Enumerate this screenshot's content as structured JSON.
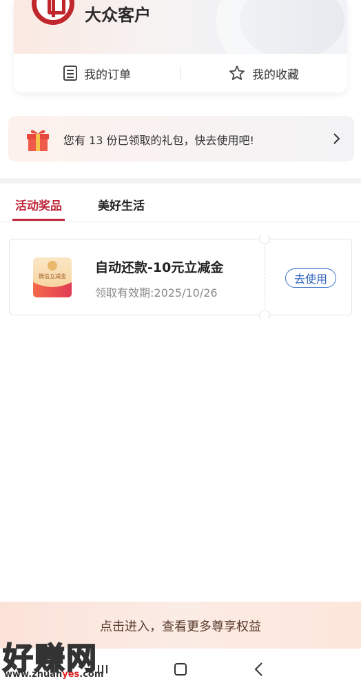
{
  "profile": {
    "name": "大众客户",
    "quick_links": [
      {
        "label": "我的订单",
        "icon": "orders-icon"
      },
      {
        "label": "我的收藏",
        "icon": "star-icon"
      }
    ]
  },
  "gift_banner": {
    "text": "您有 13 份已领取的礼包，快去使用吧!",
    "icon": "gift-icon"
  },
  "tabs": [
    {
      "label": "活动奖品",
      "active": true
    },
    {
      "label": "美好生活",
      "active": false
    }
  ],
  "coupon": {
    "title": "自动还款-10元立减金",
    "expiry": "领取有效期:2025/10/26",
    "button_label": "去使用",
    "image_label": "微信立减金"
  },
  "bottom_banner": {
    "text": "点击进入，查看更多尊享权益"
  },
  "watermark": {
    "big": "好赚网",
    "url_prefix": "www.zhuan",
    "url_highlight": "yes",
    "url_suffix": ".com"
  },
  "colors": {
    "accent": "#c0273a",
    "link_blue": "#2f62bd",
    "brand_red": "#c0272d"
  }
}
